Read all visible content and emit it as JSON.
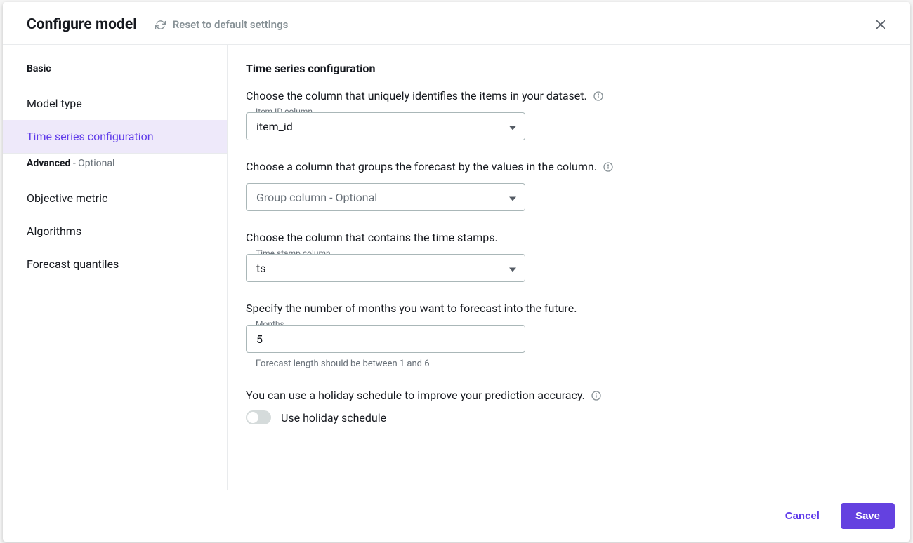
{
  "header": {
    "title": "Configure model",
    "reset_label": "Reset to default settings"
  },
  "sidebar": {
    "basic_label": "Basic",
    "advanced_label": "Advanced",
    "advanced_suffix": " - Optional",
    "items": {
      "model_type": "Model type",
      "tsc": "Time series configuration",
      "objective": "Objective metric",
      "algorithms": "Algorithms",
      "quantiles": "Forecast quantiles"
    }
  },
  "content": {
    "heading": "Time series configuration",
    "item_id": {
      "prompt": "Choose the column that uniquely identifies the items in your dataset.",
      "label": "Item ID column",
      "value": "item_id"
    },
    "group": {
      "prompt": "Choose a column that groups the forecast by the values in the column.",
      "placeholder": "Group column - Optional"
    },
    "timestamp": {
      "prompt": "Choose the column that contains the time stamps.",
      "label": "Time stamp column",
      "value": "ts"
    },
    "horizon": {
      "prompt": "Specify the number of months you want to forecast into the future.",
      "label": "Months",
      "value": "5",
      "hint": "Forecast length should be between 1 and 6"
    },
    "holiday": {
      "prompt": "You can use a holiday schedule to improve your prediction accuracy.",
      "toggle_label": "Use holiday schedule",
      "enabled": false
    }
  },
  "footer": {
    "cancel": "Cancel",
    "save": "Save"
  }
}
